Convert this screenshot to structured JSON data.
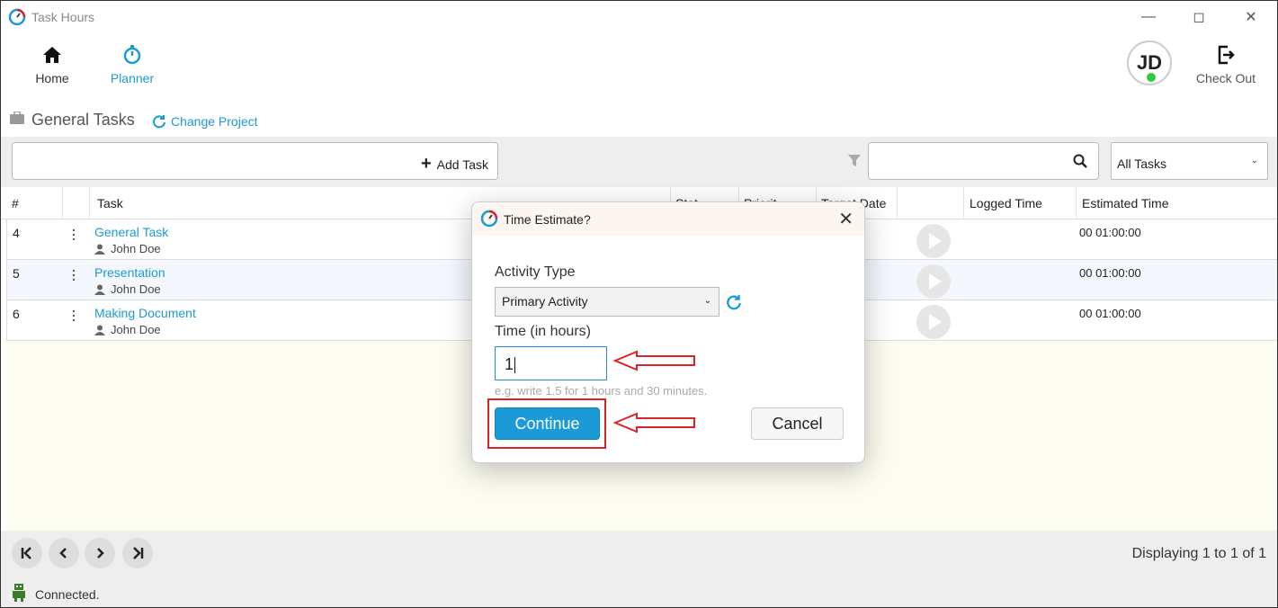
{
  "window": {
    "title": "Task Hours"
  },
  "nav": {
    "home_label": "Home",
    "planner_label": "Planner",
    "user_initials": "JD",
    "checkout_label": "Check Out"
  },
  "project": {
    "name": "General Tasks",
    "change_label": "Change Project"
  },
  "toolbar": {
    "add_task_label": "Add Task",
    "filter_value": "All Tasks"
  },
  "grid": {
    "headers": {
      "num": "#",
      "task": "Task",
      "status": "Stat",
      "priority": "Priorit",
      "target_date": "Target Date",
      "logged": "Logged Time",
      "estimated": "Estimated Time"
    },
    "rows": [
      {
        "num": "4",
        "task": "General Task",
        "user": "John Doe",
        "estimated": "00 01:00:00"
      },
      {
        "num": "5",
        "task": "Presentation",
        "user": "John Doe",
        "estimated": "00 01:00:00"
      },
      {
        "num": "6",
        "task": "Making Document",
        "user": "John Doe",
        "estimated": "00 01:00:00"
      }
    ]
  },
  "pager": {
    "display_text": "Displaying 1 to 1 of 1"
  },
  "status": {
    "text": "Connected."
  },
  "dialog": {
    "title": "Time Estimate?",
    "activity_label": "Activity Type",
    "activity_value": "Primary Activity",
    "time_label": "Time (in hours)",
    "time_value": "1",
    "hint": "e.g. write 1.5 for 1 hours and 30 minutes.",
    "continue_label": "Continue",
    "cancel_label": "Cancel"
  },
  "colors": {
    "accent": "#1a9ad6",
    "annotation": "#d8232a",
    "online": "#2ecc40"
  }
}
